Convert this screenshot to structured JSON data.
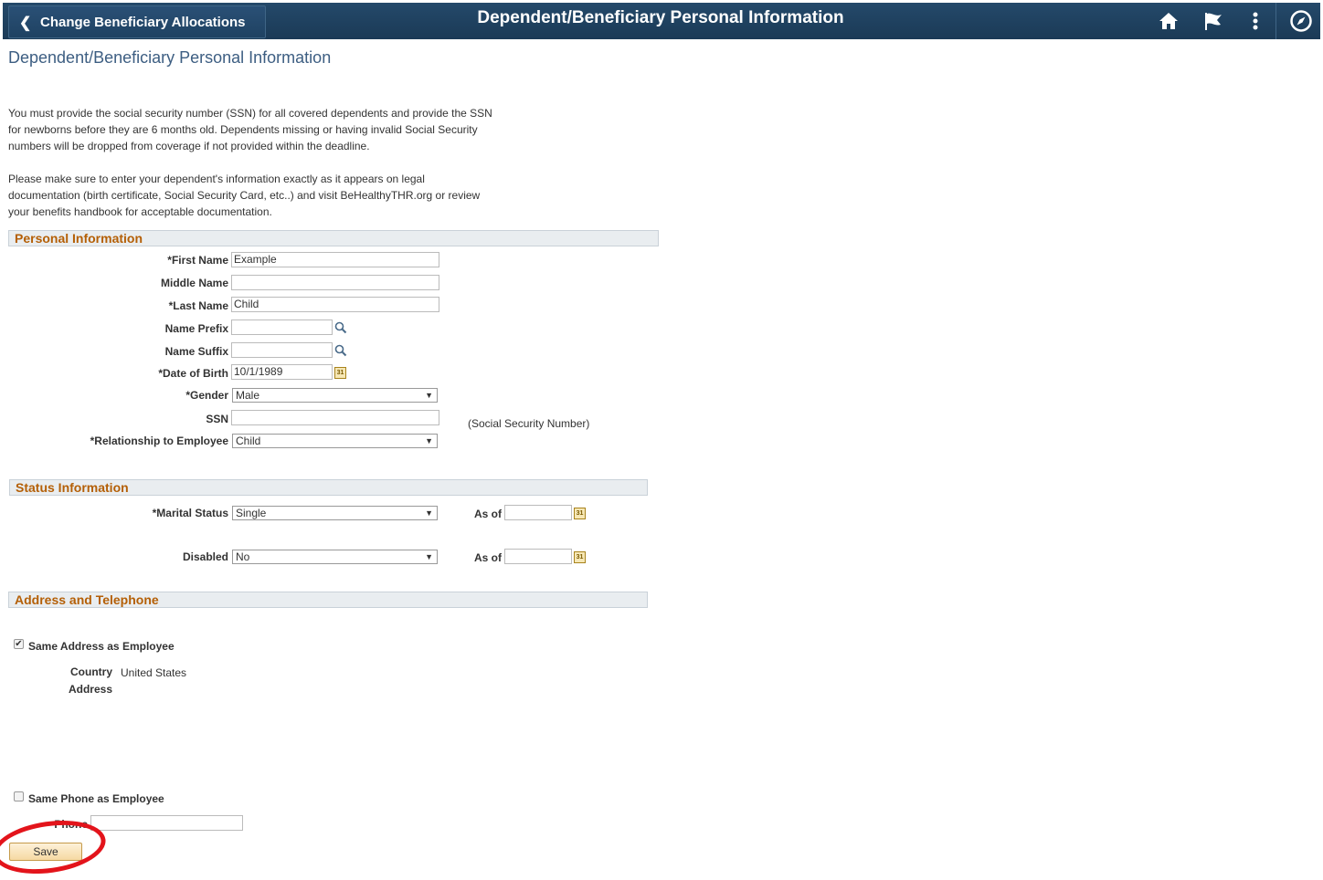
{
  "header": {
    "back_label": "Change Beneficiary Allocations",
    "title": "Dependent/Beneficiary Personal Information",
    "icons": [
      "home-icon",
      "flag-icon",
      "more-vert-icon",
      "compass-icon"
    ]
  },
  "page": {
    "title": "Dependent/Beneficiary Personal Information",
    "para1": [
      "You must provide the social security number (SSN) for all covered dependents and provide the SSN",
      "for newborns before they are 6 months old. Dependents missing or having invalid Social Security",
      "numbers will be dropped from coverage if not provided within the deadline."
    ],
    "para2": [
      "Please make sure to enter your dependent's information exactly as it appears on legal",
      "documentation (birth certificate, Social Security Card, etc..) and visit BeHealthyTHR.org or review",
      "your benefits handbook for acceptable documentation."
    ]
  },
  "personal": {
    "header": "Personal Information",
    "first_name_label": "*First Name",
    "first_name_value": "Example",
    "middle_name_label": "Middle Name",
    "middle_name_value": "",
    "last_name_label": "*Last Name",
    "last_name_value": "Child",
    "prefix_label": "Name Prefix",
    "prefix_value": "",
    "suffix_label": "Name Suffix",
    "suffix_value": "",
    "dob_label": "*Date of Birth",
    "dob_value": "10/1/1989",
    "gender_label": "*Gender",
    "gender_value": "Male",
    "ssn_label": "SSN",
    "ssn_value": "",
    "ssn_note": "(Social Security Number)",
    "relationship_label": "*Relationship to Employee",
    "relationship_value": "Child"
  },
  "status": {
    "header": "Status Information",
    "marital_label": "*Marital Status",
    "marital_value": "Single",
    "marital_asof_label": "As of",
    "marital_asof_value": "",
    "disabled_label": "Disabled",
    "disabled_value": "No",
    "disabled_asof_label": "As of",
    "disabled_asof_value": ""
  },
  "address": {
    "header": "Address and Telephone",
    "same_address_label": "Same Address as Employee",
    "same_address_checked": true,
    "country_label": "Country",
    "country_value": "United States",
    "address_label": "Address",
    "same_phone_label": "Same Phone as Employee",
    "same_phone_checked": false,
    "phone_label": "Phone",
    "phone_value": ""
  },
  "actions": {
    "save_label": "Save"
  },
  "colors": {
    "header_bg": "#1e3f5c",
    "section_text": "#b45f06",
    "annotation_ring": "#e3141b"
  }
}
